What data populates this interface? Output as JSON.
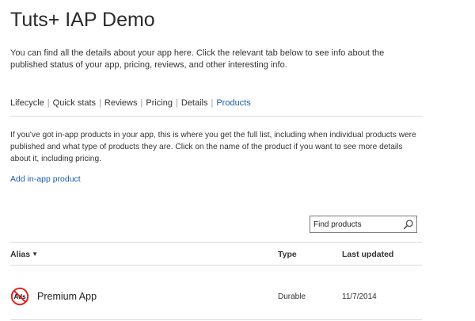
{
  "header": {
    "title": "Tuts+ IAP Demo",
    "intro": "You can find all the details about your app here. Click the relevant tab below to see info about the published status of your app, pricing, reviews, and other interesting info."
  },
  "tabs": [
    {
      "label": "Lifecycle",
      "active": false
    },
    {
      "label": "Quick stats",
      "active": false
    },
    {
      "label": "Reviews",
      "active": false
    },
    {
      "label": "Pricing",
      "active": false
    },
    {
      "label": "Details",
      "active": false
    },
    {
      "label": "Products",
      "active": true
    }
  ],
  "products": {
    "description": "If you've got in-app products in your app, this is where you get the full list, including when individual products were published and what type of products they are. Click on the name of the product if you want to see more details about it, including pricing.",
    "add_link": "Add in-app product",
    "search": {
      "placeholder": "Find products",
      "icon": "search-icon"
    },
    "columns": {
      "alias": "Alias",
      "type": "Type",
      "last_updated": "Last updated"
    },
    "rows": [
      {
        "icon": "no-ads-icon",
        "icon_text": "Ads",
        "name": "Premium App",
        "type": "Durable",
        "last_updated": "11/7/2014"
      }
    ]
  },
  "colors": {
    "link": "#1a5ea8",
    "divider": "#d9d9d9",
    "no_ads_red": "#e02020"
  }
}
